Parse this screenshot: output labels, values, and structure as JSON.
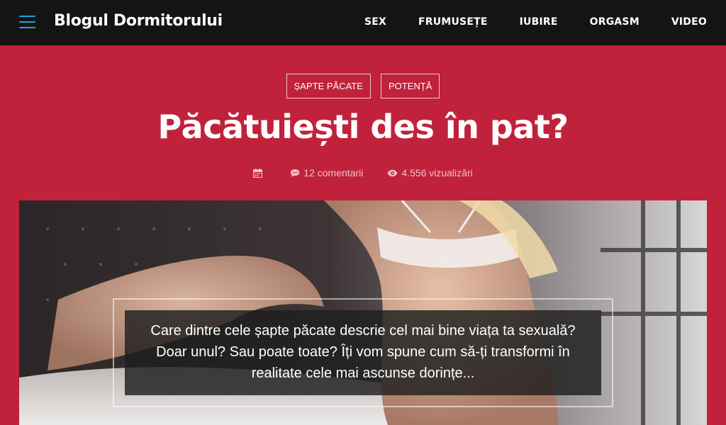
{
  "header": {
    "site_title": "Blogul Dormitorului",
    "menu_icon": "hamburger-menu-icon",
    "nav": [
      "SEX",
      "FRUMUSEȚE",
      "IUBIRE",
      "ORGASM",
      "VIDEO"
    ],
    "accent_color": "#1fa5d6"
  },
  "article": {
    "tags": [
      "ȘAPTE PĂCATE",
      "POTENȚĂ"
    ],
    "title": "Păcătuiești des în pat?",
    "meta": {
      "date_icon": "calendar-icon",
      "comments_icon": "comment-icon",
      "comments": "12 comentarii",
      "views_icon": "eye-icon",
      "views": "4.556 vizualizări"
    },
    "excerpt": "Care dintre cele șapte păcate descrie cel mai bine viața ta sexuală? Doar unul? Sau poate toate? Îți vom spune cum să-ți transformi în realitate cele mai ascunse dorințe..."
  },
  "colors": {
    "page_background": "#c0223c",
    "topbar_background": "#141414"
  }
}
